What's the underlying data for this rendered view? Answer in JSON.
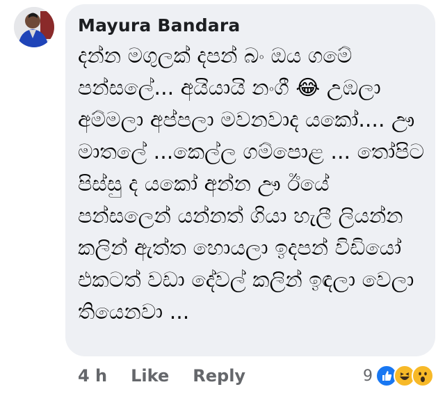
{
  "comment": {
    "author": "Mayura Bandara",
    "text": "දන්න මගුලක් දපන් බං ඔය ගමේ පන්සලේ... අයියායි නංගී 😂 උඹලා අම්මලා අප්පලා මවනවාද යකෝ.... ඌ මාතලේ ...කෙල්ල ගම්පොළ ... තෝපිට පිස්සු ද යකෝ අන්න ඌ ඊයේ පන්සලෙන් යන්නත් ගියා හැලී ලියන්න කලින් ඇත්ත හොයලා ඉදපන් විඩියෝ එකටත් වඩා දේවල් කලින් ඉඳලා වෙලා තියෙනවා ...",
    "timestamp": "4 h",
    "like_label": "Like",
    "reply_label": "Reply",
    "reaction_count": "9",
    "reactions": [
      {
        "icon": "like-reaction-icon",
        "color": "#1877f2"
      },
      {
        "icon": "haha-reaction-icon",
        "color": "#f7b928"
      },
      {
        "icon": "wow-reaction-icon",
        "color": "#f7b928"
      }
    ]
  }
}
